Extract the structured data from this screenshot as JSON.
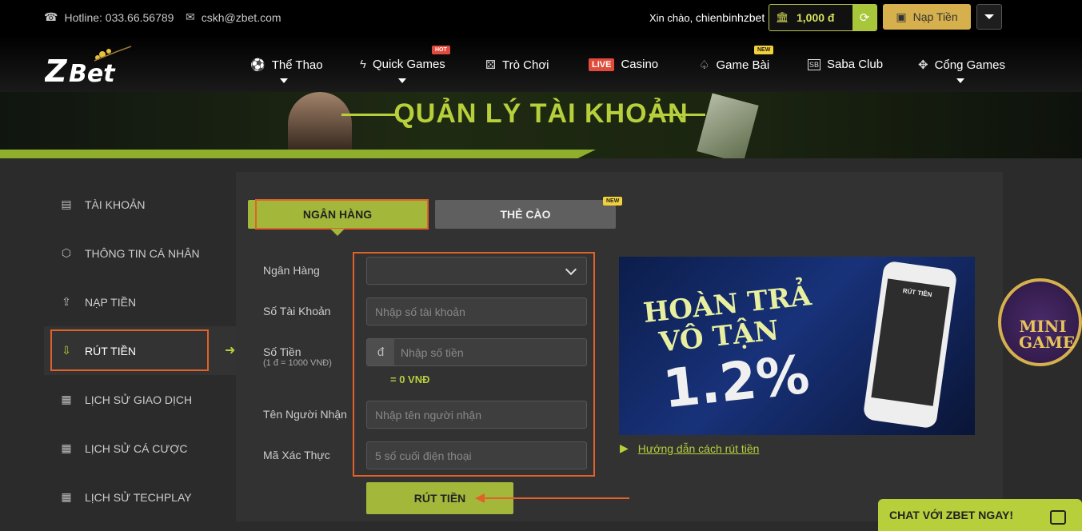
{
  "topbar": {
    "hotline": "Hotline: 033.66.56789",
    "email": "cskh@zbet.com",
    "greeting": "Xin chào,",
    "username": "chienbinhzbet",
    "balance": "1,000 đ",
    "deposit_label": "Nạp Tiền"
  },
  "logo": {
    "text": "ZBet"
  },
  "nav": {
    "items": [
      {
        "label": "Thể Thao",
        "icon": "soccer-ball-icon"
      },
      {
        "label": "Quick Games",
        "icon": "lightning-icon",
        "badge": "HOT"
      },
      {
        "label": "Trò Chơi",
        "icon": "dice-icon"
      },
      {
        "label": "Casino",
        "icon": "live-badge",
        "prefix": "LIVE"
      },
      {
        "label": "Game Bài",
        "icon": "spade-icon",
        "badge": "NEW"
      },
      {
        "label": "Saba Club",
        "icon": "saba-icon",
        "prefix": "SB"
      },
      {
        "label": "Cổng Games",
        "icon": "gamepad-icon"
      }
    ]
  },
  "banner": {
    "title": "QUẢN LÝ TÀI KHOẢN"
  },
  "sidebar": {
    "items": [
      {
        "label": "TÀI KHOẢN",
        "icon": "account-icon"
      },
      {
        "label": "THÔNG TIN CÁ NHÂN",
        "icon": "profile-icon"
      },
      {
        "label": "NẠP TIỀN",
        "icon": "deposit-icon"
      },
      {
        "label": "RÚT TIỀN",
        "icon": "withdraw-icon",
        "active": true
      },
      {
        "label": "LỊCH SỬ GIAO DỊCH",
        "icon": "calendar-icon"
      },
      {
        "label": "LỊCH SỬ CÁ CƯỢC",
        "icon": "calendar-icon"
      },
      {
        "label": "LỊCH SỬ TECHPLAY",
        "icon": "calendar-icon"
      }
    ]
  },
  "tabs": {
    "bank": "NGÂN HÀNG",
    "card": "THẺ CÀO",
    "card_badge": "NEW"
  },
  "form": {
    "bank_label": "Ngân Hàng",
    "bank_value": "",
    "account_label": "Số Tài Khoản",
    "account_placeholder": "Nhập số tài khoản",
    "amount_label": "Số Tiền",
    "amount_note": "(1 đ = 1000 VNĐ)",
    "currency_symbol": "đ",
    "amount_placeholder": "Nhập số tiền",
    "conversion": "= 0 VNĐ",
    "receiver_label": "Tên Người Nhận",
    "receiver_placeholder": "Nhập tên người nhận",
    "code_label": "Mã Xác Thực",
    "code_placeholder": "5 số cuối điện thoại",
    "submit_label": "RÚT TIỀN"
  },
  "promo": {
    "line1": "HOÀN TRẢ",
    "line2": "VÔ TẬN",
    "rate": "1.2%",
    "phone_title": "RÚT TIỀN"
  },
  "guide_link": "Hướng dẫn cách rút tiền",
  "minigame": {
    "line1": "MINI",
    "line2": "GAME"
  },
  "chat": {
    "label": "CHAT VỚI ZBET NGAY!"
  },
  "colors": {
    "accent": "#a3b83a",
    "highlight": "#e0622a",
    "gold": "#d6b04d"
  }
}
